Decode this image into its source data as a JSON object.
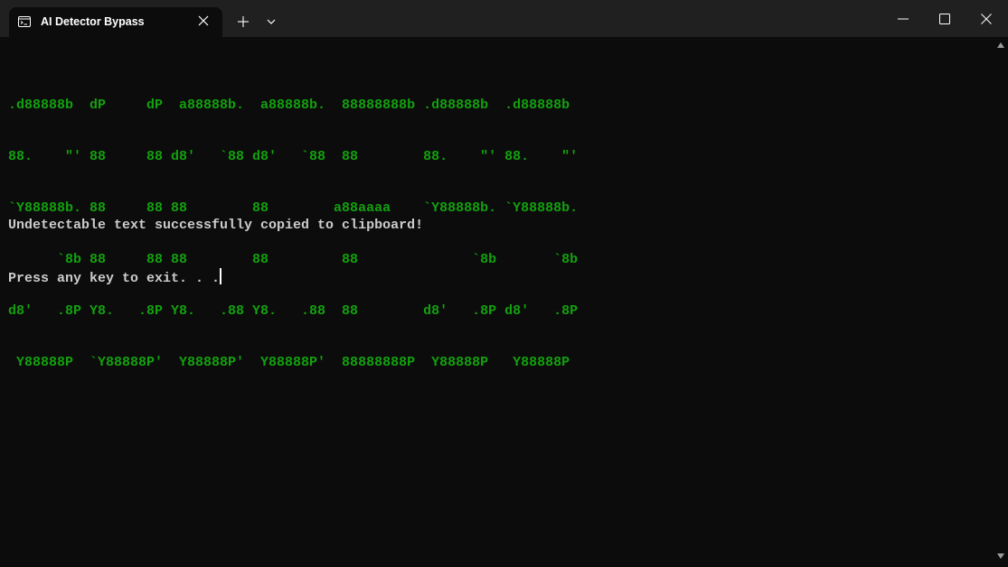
{
  "window": {
    "tab_title": "AI Detector Bypass",
    "tab_icon": "terminal-icon",
    "close_tab_icon": "close-icon",
    "new_tab_icon": "plus-icon",
    "dropdown_icon": "chevron-down-icon",
    "minimize_icon": "minimize-icon",
    "maximize_icon": "maximize-icon",
    "close_window_icon": "close-icon"
  },
  "terminal": {
    "banner_lines": [
      ".d88888b  dP     dP  a88888b.  a88888b.  88888888b .d88888b  .d88888b",
      "88.    \"' 88     88 d8'   `88 d8'   `88  88        88.    \"' 88.    \"'",
      "`Y88888b. 88     88 88        88        a88aaaa    `Y88888b. `Y88888b.",
      "      `8b 88     88 88        88         88              `8b       `8b",
      "d8'   .8P Y8.   .8P Y8.   .88 Y8.   .88  88        d8'   .8P d8'   .8P",
      " Y88888P  `Y88888P'  Y88888P'  Y88888P'  88888888P  Y88888P   Y88888P"
    ],
    "success_message": "Undetectable text successfully copied to clipboard!",
    "prompt_message": "Press any key to exit. . .",
    "banner_color": "#13a10e",
    "text_color": "#cccccc",
    "background_color": "#0c0c0c"
  }
}
